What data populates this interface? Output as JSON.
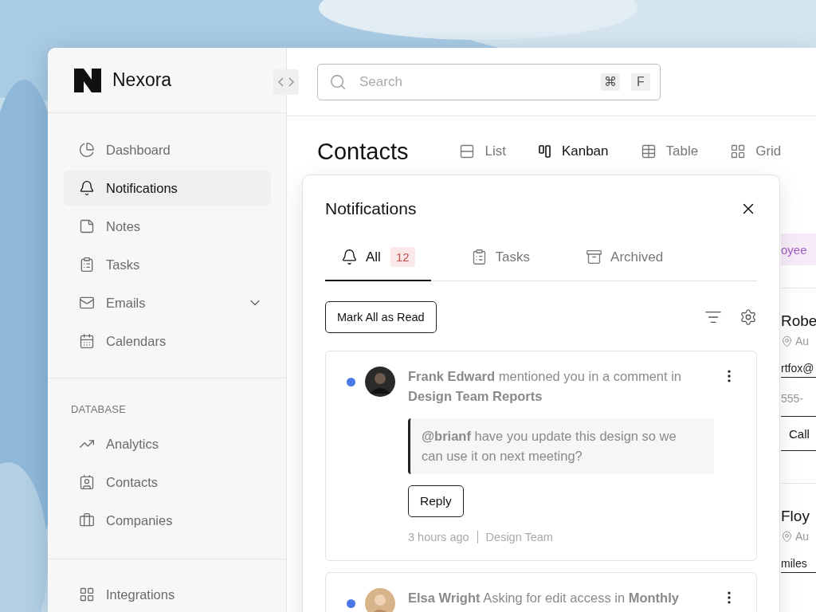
{
  "app": {
    "name": "Nexora"
  },
  "sidebar": {
    "sections": [
      {
        "items": [
          {
            "label": "Dashboard",
            "selected": false,
            "expandable": false
          },
          {
            "label": "Notifications",
            "selected": true,
            "expandable": false
          },
          {
            "label": "Notes",
            "selected": false,
            "expandable": false
          },
          {
            "label": "Tasks",
            "selected": false,
            "expandable": false
          },
          {
            "label": "Emails",
            "selected": false,
            "expandable": true
          },
          {
            "label": "Calendars",
            "selected": false,
            "expandable": false
          }
        ]
      },
      {
        "title": "DATABASE",
        "items": [
          {
            "label": "Analytics",
            "selected": false,
            "expandable": false
          },
          {
            "label": "Contacts",
            "selected": false,
            "expandable": false
          },
          {
            "label": "Companies",
            "selected": false,
            "expandable": false
          }
        ]
      },
      {
        "items": [
          {
            "label": "Integrations",
            "selected": false,
            "expandable": false
          }
        ]
      }
    ]
  },
  "search": {
    "placeholder": "Search",
    "shortcut": [
      "⌘",
      "F"
    ]
  },
  "page": {
    "title": "Contacts",
    "views": [
      {
        "label": "List",
        "selected": false
      },
      {
        "label": "Kanban",
        "selected": true
      },
      {
        "label": "Table",
        "selected": false
      },
      {
        "label": "Grid",
        "selected": false
      }
    ]
  },
  "board_peek": {
    "tag": "oyee",
    "cards": [
      {
        "name": "Robe",
        "location": "Au",
        "email": "rtfox@",
        "phone": "555-",
        "button": "Call"
      },
      {
        "name": "Floy",
        "location": "Au",
        "email": "miles"
      }
    ]
  },
  "notifications": {
    "title": "Notifications",
    "tabs": [
      {
        "label": "All",
        "count": "12",
        "selected": true
      },
      {
        "label": "Tasks",
        "selected": false
      },
      {
        "label": "Archived",
        "selected": false
      }
    ],
    "mark_all_button": "Mark All as Read",
    "items": [
      {
        "unread": true,
        "message": "**Frank Edward** mentioned you in a comment in **Design Team Reports**",
        "quote": "**@brianf** have you update this design so we can use it on next meeting?",
        "reply_button": "Reply",
        "time": "3 hours ago",
        "group": "Design Team"
      },
      {
        "unread": true,
        "message": "**Elsa Wright** Asking for edit access in **Monthly**"
      }
    ]
  }
}
